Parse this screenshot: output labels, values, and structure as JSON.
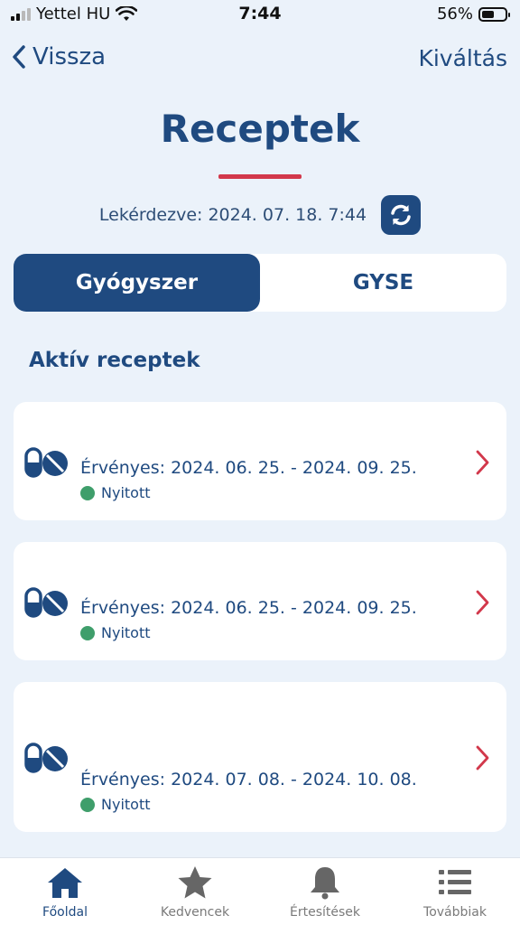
{
  "status_bar": {
    "carrier": "Yettel HU",
    "time": "7:44",
    "battery": "56%"
  },
  "nav": {
    "back_label": "Vissza",
    "action_label": "Kiváltás"
  },
  "page": {
    "title": "Receptek",
    "fetched": "Lekérdezve: 2024. 07. 18. 7:44"
  },
  "tabs": {
    "medicine": "Gyógyszer",
    "gyse": "GYSE"
  },
  "section": {
    "title": "Aktív receptek"
  },
  "prescriptions": [
    {
      "validity": "Érvényes: 2024. 06. 25. - 2024. 09. 25.",
      "status": "Nyitott"
    },
    {
      "validity": "Érvényes: 2024. 06. 25. - 2024. 09. 25.",
      "status": "Nyitott"
    },
    {
      "validity": "Érvényes: 2024. 07. 08. - 2024. 10. 08.",
      "status": "Nyitott"
    }
  ],
  "bottom_nav": [
    {
      "label": "Főoldal",
      "icon": "home-icon",
      "active": true
    },
    {
      "label": "Kedvencek",
      "icon": "star-icon",
      "active": false
    },
    {
      "label": "Értesítések",
      "icon": "bell-icon",
      "active": false
    },
    {
      "label": "Továbbiak",
      "icon": "list-icon",
      "active": false
    }
  ],
  "colors": {
    "brand": "#1f4a80",
    "accent": "#d2384b",
    "status_open": "#3f9e6b",
    "background": "#ebf2fa"
  }
}
